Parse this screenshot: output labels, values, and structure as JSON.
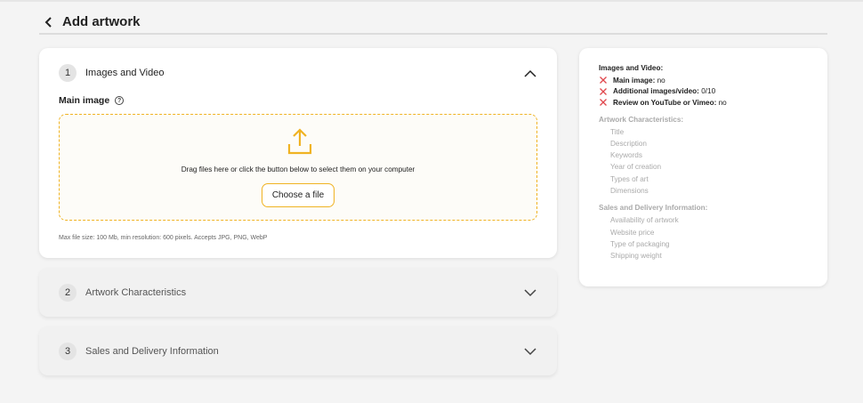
{
  "header": {
    "title": "Add artwork"
  },
  "steps": [
    {
      "num": "1",
      "title": "Images and Video"
    },
    {
      "num": "2",
      "title": "Artwork Characteristics"
    },
    {
      "num": "3",
      "title": "Sales and Delivery Information"
    }
  ],
  "upload": {
    "label": "Main image",
    "help": "?",
    "drop_text": "Drag files here or click the button below to select them on your computer",
    "button": "Choose a file",
    "note": "Max file size: 100 Mb, min resolution: 600 pixels. Accepts JPG, PNG, WebP"
  },
  "summary": {
    "images": {
      "title": "Images and Video:",
      "rows": [
        {
          "key": "Main image:",
          "value": "no"
        },
        {
          "key": "Additional images/video:",
          "value": "0/10"
        },
        {
          "key": "Review on YouTube or Vimeo:",
          "value": "no"
        }
      ]
    },
    "characteristics": {
      "title": "Artwork Characteristics:",
      "items": [
        "Title",
        "Description",
        "Keywords",
        "Year of creation",
        "Types of art",
        "Dimensions"
      ]
    },
    "sales": {
      "title": "Sales and Delivery Information:",
      "items": [
        "Availability of artwork",
        "Website price",
        "Type of packaging",
        "Shipping weight"
      ]
    }
  },
  "colors": {
    "accent": "#f0b323",
    "error": "#e0474c"
  }
}
